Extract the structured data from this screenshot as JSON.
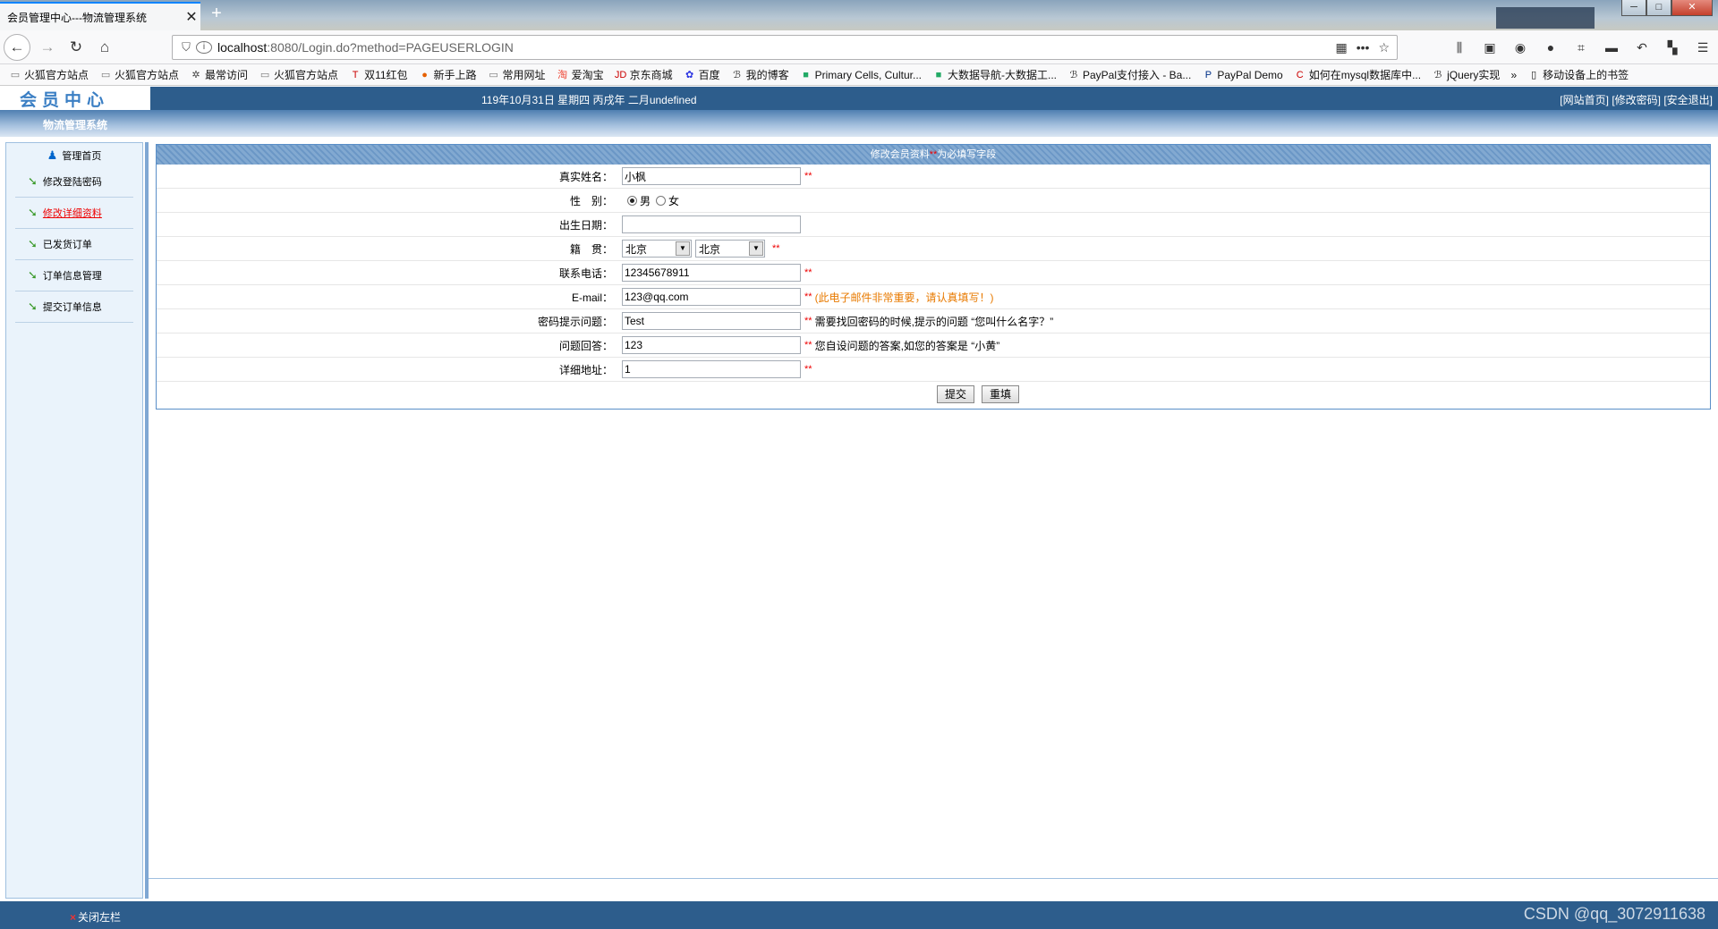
{
  "browser": {
    "tab_title": "会员管理中心---物流管理系统",
    "tab_close": "✕",
    "new_tab": "+",
    "url_host": "localhost",
    "url_rest": ":8080/Login.do?method=PAGEUSERLOGIN",
    "bookmarks": [
      {
        "label": "火狐官方站点",
        "icon": "folder-icon"
      },
      {
        "label": "火狐官方站点",
        "icon": "folder-icon"
      },
      {
        "label": "最常访问",
        "icon": "gear-icon"
      },
      {
        "label": "火狐官方站点",
        "icon": "folder-icon"
      },
      {
        "label": "双11红包",
        "icon": "tmall-icon"
      },
      {
        "label": "新手上路",
        "icon": "firefox-icon"
      },
      {
        "label": "常用网址",
        "icon": "folder-icon"
      },
      {
        "label": "爱淘宝",
        "icon": "taobao-icon"
      },
      {
        "label": "京东商城",
        "icon": "jd-icon"
      },
      {
        "label": "百度",
        "icon": "baidu-icon"
      },
      {
        "label": "我的博客",
        "icon": "blog-icon"
      },
      {
        "label": "Primary Cells, Cultur...",
        "icon": "site-icon"
      },
      {
        "label": "大数据导航-大数据工...",
        "icon": "site-icon"
      },
      {
        "label": "PayPal支付接入 - Ba...",
        "icon": "blog-icon"
      },
      {
        "label": "PayPal Demo",
        "icon": "paypal-icon"
      },
      {
        "label": "如何在mysql数据库中...",
        "icon": "csdn-icon"
      },
      {
        "label": "jQuery实现",
        "icon": "blog-icon"
      }
    ],
    "bookmarks_overflow": "»",
    "mobile_bookmarks": "移动设备上的书签"
  },
  "header": {
    "logo_text": "会员中心",
    "date_text": "119年10月31日 星期四 丙戌年 二月undefined",
    "links": [
      "[网站首页]",
      "[修改密码]",
      "[安全退出]"
    ],
    "system_title": "物流管理系统"
  },
  "sidebar": {
    "home": "管理首页",
    "items": [
      {
        "label": "修改登陆密码",
        "active": false
      },
      {
        "label": "修改详细资料",
        "active": true
      },
      {
        "label": "已发货订单",
        "active": false
      },
      {
        "label": "订单信息管理",
        "active": false
      },
      {
        "label": "提交订单信息",
        "active": false
      }
    ]
  },
  "form": {
    "title": "修改会员资料",
    "title_star": "**",
    "title_suffix": "为必填写字段",
    "real_name_label": "真实姓名：",
    "real_name_value": "小枫",
    "gender_label": "性　别：",
    "gender_male": "男",
    "gender_female": "女",
    "birth_label": "出生日期：",
    "birth_value": "",
    "native_label": "籍　贯：",
    "province": "北京",
    "city": "北京",
    "phone_label": "联系电话：",
    "phone_value": "12345678911",
    "email_label": "E-mail：",
    "email_value": "123@qq.com",
    "email_hint": "(此电子邮件非常重要，请认真填写！)",
    "question_label": "密码提示问题：",
    "question_value": "Test",
    "question_hint": "需要找回密码的时候,提示的问题 “您叫什么名字？”",
    "answer_label": "问题回答：",
    "answer_value": "123",
    "answer_hint": "您自设问题的答案,如您的答案是 “小黄”",
    "address_label": "详细地址：",
    "address_value": "1",
    "required_mark": "**",
    "submit": "提交",
    "reset": "重填"
  },
  "footer": {
    "close_left": "关闭左栏",
    "close_x": "×",
    "watermark": "CSDN @qq_3072911638"
  }
}
